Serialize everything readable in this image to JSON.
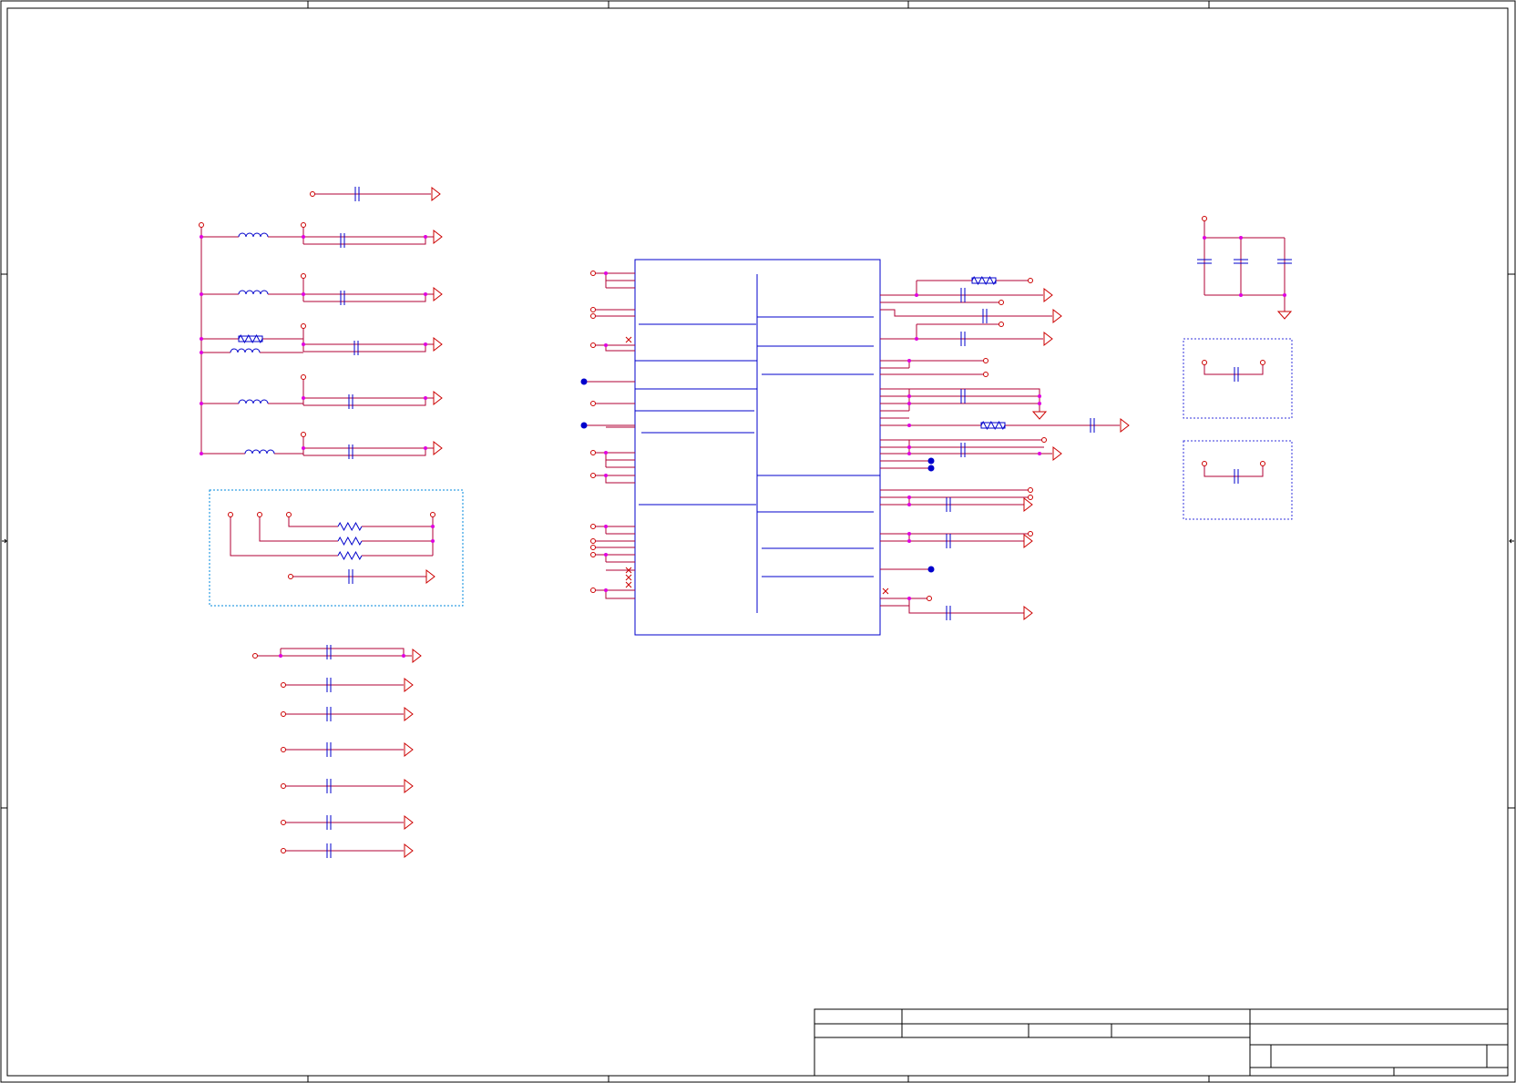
{
  "colors": {
    "frame": "#000000",
    "wire": "#b00035",
    "pin": "#cc0000",
    "component": "#0000cc",
    "junction": "#e000e0",
    "dashed_box_left": "#0088dd",
    "dashed_box_right": "#3333dd",
    "background": "#ffffff"
  },
  "sheet": {
    "title_block": {
      "fields": [
        "",
        "",
        "",
        "",
        "",
        "",
        "",
        "",
        "",
        ""
      ]
    }
  },
  "symbols": {
    "ic": "integrated-circuit",
    "inductor": "inductor",
    "ferrite": "ferrite-bead",
    "capacitor": "capacitor",
    "resistor": "resistor",
    "ground": "ground-triangle",
    "net_port": "open-circle-port",
    "no_connect": "no-connect-cross"
  }
}
